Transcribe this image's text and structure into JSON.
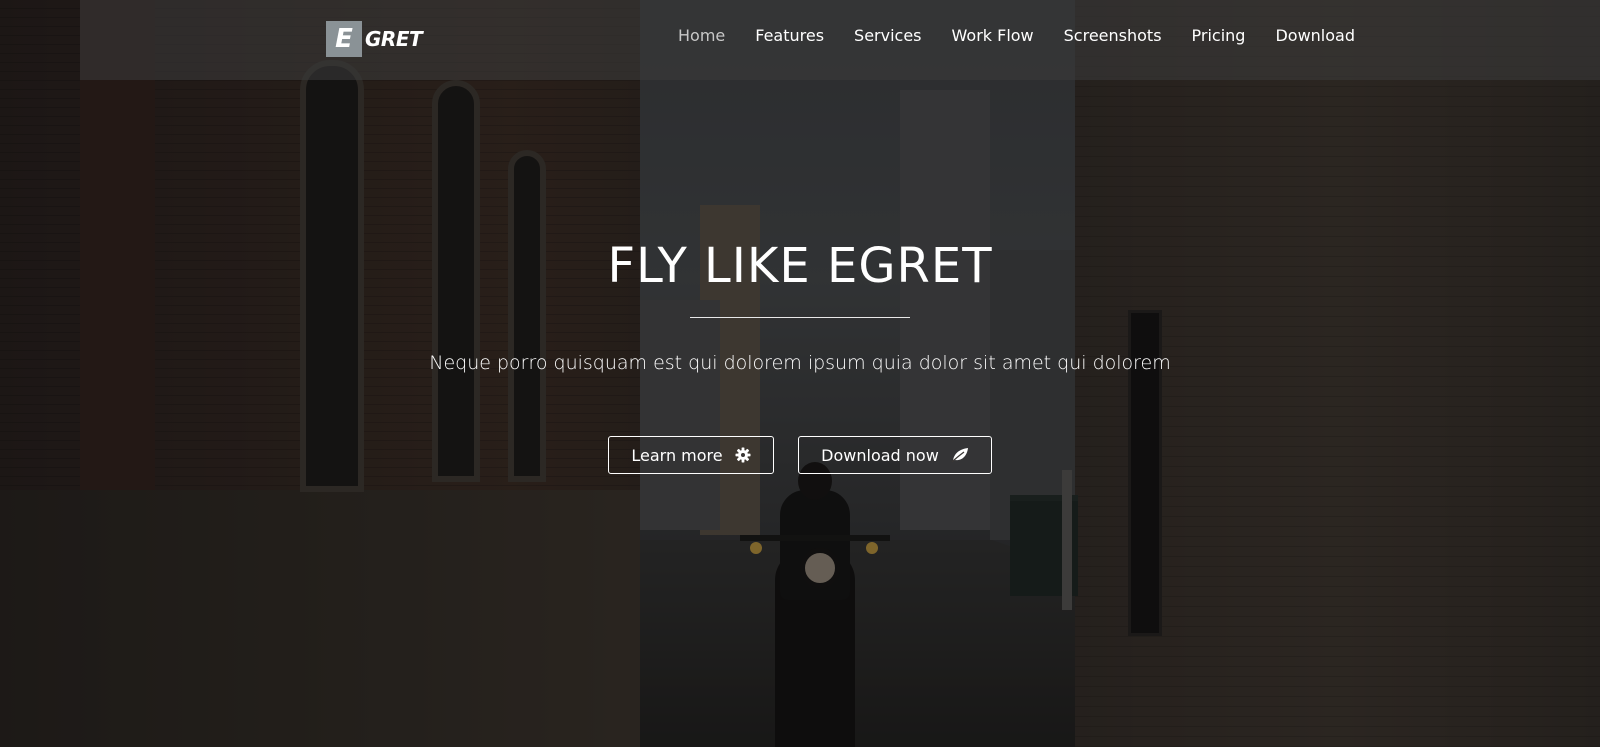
{
  "brand": {
    "logo_letter": "E",
    "logo_text": "GRET",
    "logo_box_color": "#8a9296"
  },
  "nav": {
    "items": [
      {
        "label": "Home",
        "active": true
      },
      {
        "label": "Features",
        "active": false
      },
      {
        "label": "Services",
        "active": false
      },
      {
        "label": "Work Flow",
        "active": false
      },
      {
        "label": "Screenshots",
        "active": false
      },
      {
        "label": "Pricing",
        "active": false
      },
      {
        "label": "Download",
        "active": false
      }
    ]
  },
  "hero": {
    "title": "FLY LIKE EGRET",
    "subtitle": "Neque porro quisquam est qui dolorem ipsum quia dolor sit amet qui dolorem",
    "buttons": {
      "learn_more": {
        "label": "Learn more",
        "icon": "gear-icon"
      },
      "download_now": {
        "label": "Download now",
        "icon": "leaf-icon"
      }
    }
  }
}
